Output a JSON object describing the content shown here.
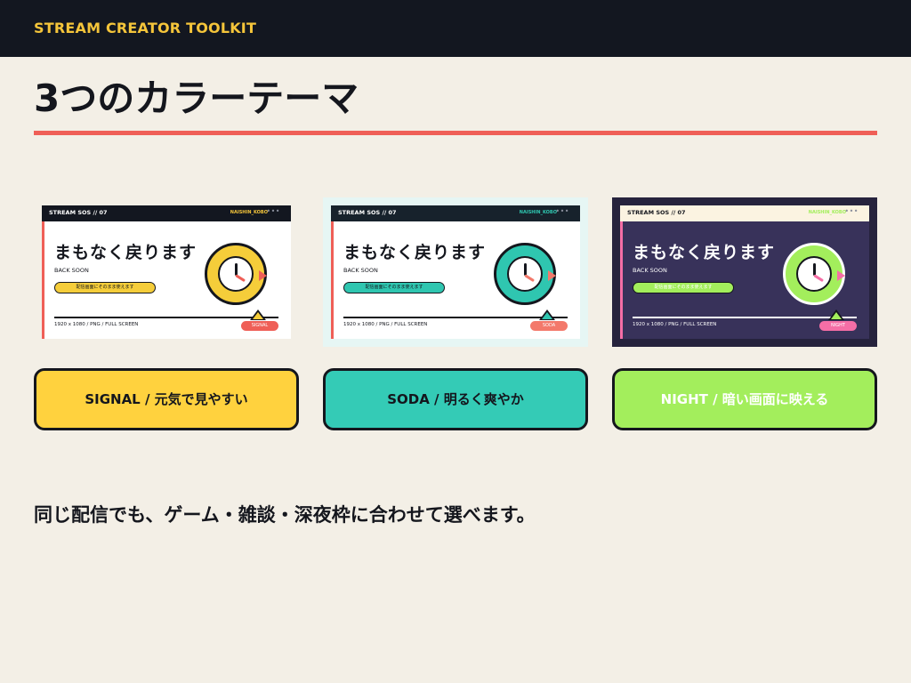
{
  "header": {
    "brand": "STREAM CREATOR TOOLKIT"
  },
  "page": {
    "title": "3つのカラーテーマ",
    "caption": "同じ配信でも、ゲーム・雑談・深夜枠に合わせて選べます。"
  },
  "themes": [
    {
      "button_label": "SIGNAL / 元気で見やすい",
      "button_color": "#ffd23e",
      "preview": {
        "head_label": "STREAM SOS // 07",
        "handle": "NAISHIN_KOBO",
        "heading": "まもなく戻ります",
        "subheading": "BACK SOON",
        "pill_text": "配信画面にそのまま使えます",
        "spec": "1920 x 1080 / PNG / FULL SCREEN",
        "tag": "SIGNAL",
        "frame_color": "#f3efe6",
        "bg_color": "#ffffff",
        "head_color": "#131720",
        "edge_color": "#ef5f57",
        "accent_color": "#f5cd3a",
        "tag_color": "#ef5f57",
        "text_color": "#14161d",
        "handle_color": "#f5c53a"
      }
    },
    {
      "button_label": "SODA / 明るく爽やか",
      "button_color": "#34cbb6",
      "preview": {
        "head_label": "STREAM SOS // 07",
        "handle": "NAISHIN_KOBO",
        "heading": "まもなく戻ります",
        "subheading": "BACK SOON",
        "pill_text": "配信画面にそのまま使えます",
        "spec": "1920 x 1080 / PNG / FULL SCREEN",
        "tag": "SODA",
        "frame_color": "#e6f6f4",
        "bg_color": "#ffffff",
        "head_color": "#17222c",
        "edge_color": "#ef5f57",
        "accent_color": "#2fc6b0",
        "tag_color": "#f3796b",
        "text_color": "#14161d",
        "handle_color": "#2fc6b0"
      }
    },
    {
      "button_label": "NIGHT / 暗い画面に映える",
      "button_color": "#a3ee5c",
      "preview": {
        "head_label": "STREAM SOS // 07",
        "handle": "NAISHIN_KOBO",
        "heading": "まもなく戻ります",
        "subheading": "BACK SOON",
        "pill_text": "配信画面にそのまま使えます",
        "spec": "1920 x 1080 / PNG / FULL SCREEN",
        "tag": "NIGHT",
        "frame_color": "#26233d",
        "bg_color": "#38325a",
        "head_color": "#fbf3e1",
        "edge_color": "#f56ea6",
        "accent_color": "#a3ee5c",
        "tag_color": "#f56ea6",
        "text_color": "#ffffff",
        "handle_color": "#a3ee5c"
      }
    }
  ]
}
